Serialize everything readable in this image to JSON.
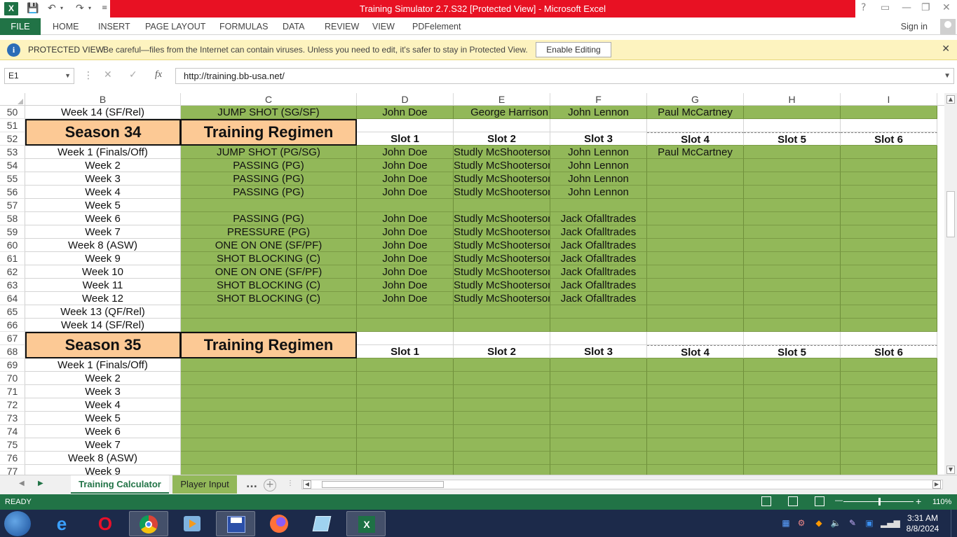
{
  "app": {
    "logo_letter": "X",
    "window_title": "Training Simulator 2.7.S32  [Protected View] -  Microsoft Excel",
    "qat": {
      "save_icon": "save-icon",
      "undo_icon": "undo-icon",
      "redo_icon": "redo-icon"
    },
    "window_controls": {
      "help": "?",
      "restore_ribbon": "▭",
      "minimize": "—",
      "maximize": "❐",
      "close": "✕"
    }
  },
  "ribbon": {
    "file_label": "FILE",
    "tabs": [
      {
        "label": "HOME"
      },
      {
        "label": "INSERT"
      },
      {
        "label": "PAGE LAYOUT"
      },
      {
        "label": "FORMULAS"
      },
      {
        "label": "DATA"
      },
      {
        "label": "REVIEW"
      },
      {
        "label": "VIEW"
      },
      {
        "label": "PDFelement"
      }
    ],
    "signin_label": "Sign in"
  },
  "protected_view": {
    "icon": "shield-info-icon",
    "title": "PROTECTED VIEW",
    "message": "Be careful—files from the Internet can contain viruses. Unless you need to edit, it's safer to stay in Protected View.",
    "button_label": "Enable Editing",
    "close_label": "✕"
  },
  "formula_bar": {
    "name_box": "E1",
    "formula": "http://training.bb-usa.net/"
  },
  "columns": [
    {
      "letter": "B"
    },
    {
      "letter": "C"
    },
    {
      "letter": "D"
    },
    {
      "letter": "E"
    },
    {
      "letter": "F"
    },
    {
      "letter": "G"
    },
    {
      "letter": "H"
    },
    {
      "letter": "I"
    }
  ],
  "rows": [
    {
      "num": "50",
      "b": "Week 14 (SF/Rel)",
      "c": "JUMP SHOT (SG/SF)",
      "d": "John Doe",
      "e": "George Harrison",
      "f": "John Lennon",
      "g": "Paul McCartney",
      "h": "",
      "i": ""
    },
    {
      "num": "51"
    },
    {
      "num": "52",
      "slots": [
        "Slot 1",
        "Slot 2",
        "Slot 3",
        "Slot 4",
        "Slot 5",
        "Slot 6"
      ]
    },
    {
      "num": "53",
      "b": "Week 1 (Finals/Off)",
      "c": "JUMP SHOT (PG/SG)",
      "d": "John Doe",
      "e": "Studly McShooterson",
      "f": "John Lennon",
      "g": "Paul McCartney",
      "h": "",
      "i": ""
    },
    {
      "num": "54",
      "b": "Week 2",
      "c": "PASSING (PG)",
      "d": "John Doe",
      "e": "Studly McShooterson",
      "f": "John Lennon",
      "g": "",
      "h": "",
      "i": ""
    },
    {
      "num": "55",
      "b": "Week 3",
      "c": "PASSING (PG)",
      "d": "John Doe",
      "e": "Studly McShooterson",
      "f": "John Lennon",
      "g": "",
      "h": "",
      "i": ""
    },
    {
      "num": "56",
      "b": "Week 4",
      "c": "PASSING (PG)",
      "d": "John Doe",
      "e": "Studly McShooterson",
      "f": "John Lennon",
      "g": "",
      "h": "",
      "i": ""
    },
    {
      "num": "57",
      "b": "Week 5",
      "c": "",
      "d": "",
      "e": "",
      "f": "",
      "g": "",
      "h": "",
      "i": ""
    },
    {
      "num": "58",
      "b": "Week 6",
      "c": "PASSING (PG)",
      "d": "John Doe",
      "e": "Studly McShooterson",
      "f": "Jack Ofalltrades",
      "g": "",
      "h": "",
      "i": ""
    },
    {
      "num": "59",
      "b": "Week 7",
      "c": "PRESSURE (PG)",
      "d": "John Doe",
      "e": "Studly McShooterson",
      "f": "Jack Ofalltrades",
      "g": "",
      "h": "",
      "i": ""
    },
    {
      "num": "60",
      "b": "Week 8 (ASW)",
      "c": "ONE ON ONE (SF/PF)",
      "d": "John Doe",
      "e": "Studly McShooterson",
      "f": "Jack Ofalltrades",
      "g": "",
      "h": "",
      "i": ""
    },
    {
      "num": "61",
      "b": "Week 9",
      "c": "SHOT BLOCKING (C)",
      "d": "John Doe",
      "e": "Studly McShooterson",
      "f": "Jack Ofalltrades",
      "g": "",
      "h": "",
      "i": ""
    },
    {
      "num": "62",
      "b": "Week 10",
      "c": "ONE ON ONE (SF/PF)",
      "d": "John Doe",
      "e": "Studly McShooterson",
      "f": "Jack Ofalltrades",
      "g": "",
      "h": "",
      "i": ""
    },
    {
      "num": "63",
      "b": "Week 11",
      "c": "SHOT BLOCKING (C)",
      "d": "John Doe",
      "e": "Studly McShooterson",
      "f": "Jack Ofalltrades",
      "g": "",
      "h": "",
      "i": ""
    },
    {
      "num": "64",
      "b": "Week 12",
      "c": "SHOT BLOCKING (C)",
      "d": "John Doe",
      "e": "Studly McShooterson",
      "f": "Jack Ofalltrades",
      "g": "",
      "h": "",
      "i": ""
    },
    {
      "num": "65",
      "b": "Week 13 (QF/Rel)",
      "c": "",
      "d": "",
      "e": "",
      "f": "",
      "g": "",
      "h": "",
      "i": ""
    },
    {
      "num": "66",
      "b": "Week 14 (SF/Rel)",
      "c": "",
      "d": "",
      "e": "",
      "f": "",
      "g": "",
      "h": "",
      "i": ""
    },
    {
      "num": "67"
    },
    {
      "num": "68",
      "slots": [
        "Slot 1",
        "Slot 2",
        "Slot 3",
        "Slot 4",
        "Slot 5",
        "Slot 6"
      ]
    },
    {
      "num": "69",
      "b": "Week 1 (Finals/Off)",
      "c": "",
      "d": "",
      "e": "",
      "f": "",
      "g": "",
      "h": "",
      "i": ""
    },
    {
      "num": "70",
      "b": "Week 2",
      "c": "",
      "d": "",
      "e": "",
      "f": "",
      "g": "",
      "h": "",
      "i": ""
    },
    {
      "num": "71",
      "b": "Week 3",
      "c": "",
      "d": "",
      "e": "",
      "f": "",
      "g": "",
      "h": "",
      "i": ""
    },
    {
      "num": "72",
      "b": "Week 4",
      "c": "",
      "d": "",
      "e": "",
      "f": "",
      "g": "",
      "h": "",
      "i": ""
    },
    {
      "num": "73",
      "b": "Week 5",
      "c": "",
      "d": "",
      "e": "",
      "f": "",
      "g": "",
      "h": "",
      "i": ""
    },
    {
      "num": "74",
      "b": "Week 6",
      "c": "",
      "d": "",
      "e": "",
      "f": "",
      "g": "",
      "h": "",
      "i": ""
    },
    {
      "num": "75",
      "b": "Week 7",
      "c": "",
      "d": "",
      "e": "",
      "f": "",
      "g": "",
      "h": "",
      "i": ""
    },
    {
      "num": "76",
      "b": "Week 8 (ASW)",
      "c": "",
      "d": "",
      "e": "",
      "f": "",
      "g": "",
      "h": "",
      "i": ""
    },
    {
      "num": "77",
      "b": "Week 9",
      "c": "",
      "d": "",
      "e": "",
      "f": "",
      "g": "",
      "h": "",
      "i": ""
    }
  ],
  "season_blocks": [
    {
      "season": "Season 34",
      "header": "Training Regimen"
    },
    {
      "season": "Season 35",
      "header": "Training Regimen"
    }
  ],
  "sheet_tabs": {
    "active": "Training Calculator",
    "other": "Player Input",
    "more": "...",
    "add": "+"
  },
  "status_bar": {
    "status": "READY",
    "zoom": "110%"
  },
  "taskbar": {
    "apps": [
      {
        "name": "start-button-icon"
      },
      {
        "name": "internet-explorer-icon"
      },
      {
        "name": "opera-icon"
      },
      {
        "name": "chrome-icon"
      },
      {
        "name": "media-player-icon"
      },
      {
        "name": "floppy-save-icon"
      },
      {
        "name": "firefox-icon"
      },
      {
        "name": "notepad-icon"
      },
      {
        "name": "excel-icon"
      }
    ],
    "time": "3:31 AM",
    "date": "8/8/2024"
  },
  "colors": {
    "cell_green": "#92b859",
    "season_fill": "#fcc995",
    "excel_green": "#217346",
    "title_red": "#e81123",
    "protected_yellow": "#fdf3bf"
  }
}
